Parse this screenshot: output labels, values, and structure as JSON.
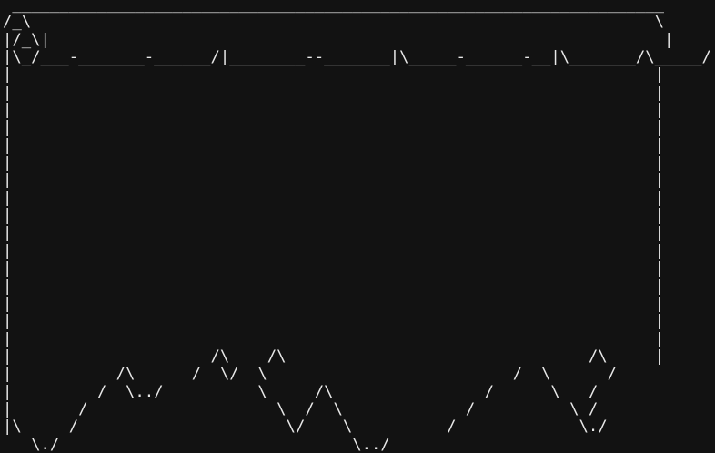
{
  "terminal": {
    "background_color": "#121212",
    "foreground_color": "#e8e8e8",
    "lines": [
      " _____________________________________________________________________",
      "/_\\                                                                  \\",
      "|/_\\|                                                                 |",
      "|\\_/___-_______-______/|________--_______|\\_____-______-__|\\_______/\\_____/",
      "|                                                                    |",
      "|                                                                    |",
      "|                                                                    |",
      "|                                                                    |",
      "|                                                                    |",
      "|                                                                    |",
      "|                                                                    |",
      "|                                                                    |",
      "|                                                                    |",
      "|                                                                    |",
      "|                                                                    |",
      "|                                                                    |",
      "|                                                                    |",
      "|                                                                    |",
      "|                                                                    |",
      "|                                                                    |",
      "|                     /\\    /\\                                /\\     |",
      "|           /\\      /  \\/  \\                          /  \\      /",
      "|         /  \\../          \\     /\\                /      \\   /",
      "|       /                    \\  /  \\             /          \\ /",
      "|\\     /                      \\/    \\          /             \\./",
      "   \\./                               \\../"
    ]
  }
}
